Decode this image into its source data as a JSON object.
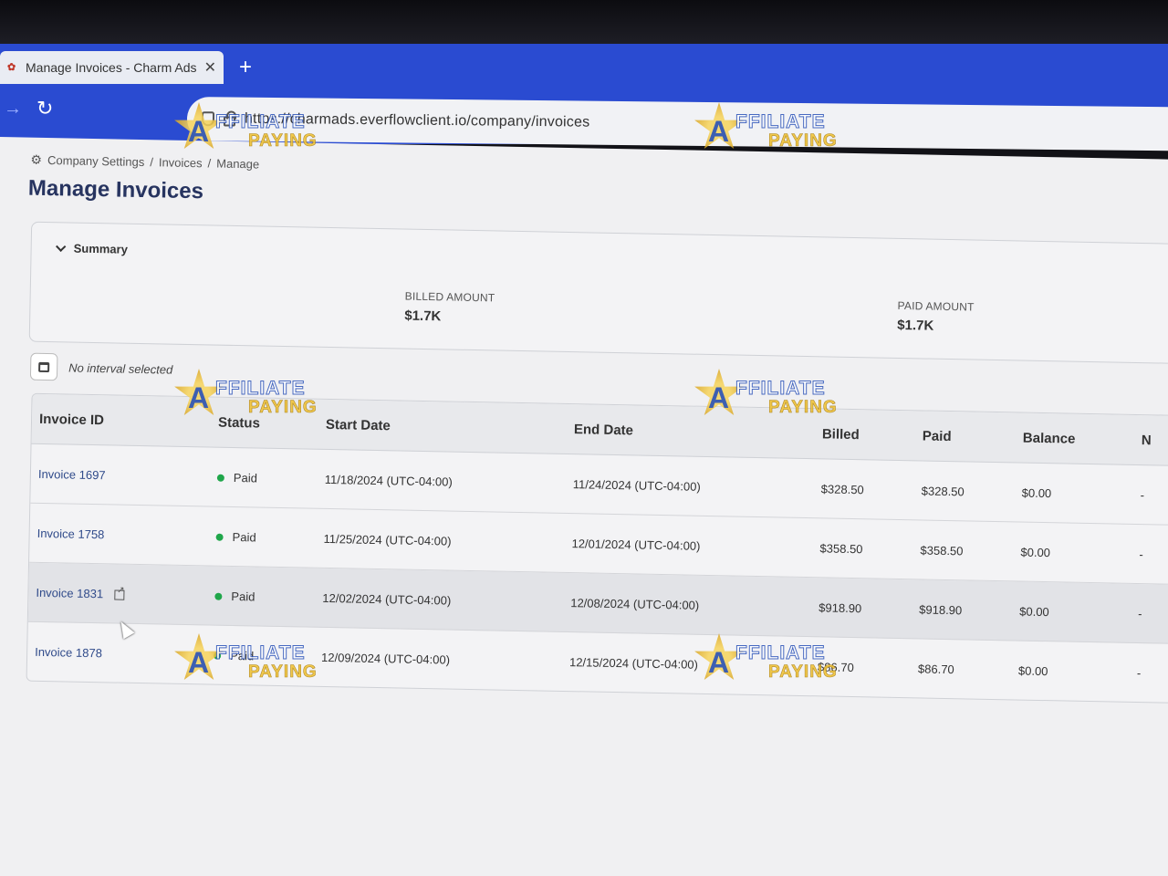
{
  "browser": {
    "tab_title": "Manage Invoices - Charm Ads",
    "tab_close": "✕",
    "new_tab": "+",
    "url": "https://charmads.everflowclient.io/company/invoices"
  },
  "breadcrumb": {
    "items": [
      "Company Settings",
      "Invoices",
      "Manage"
    ],
    "separator": "/"
  },
  "page_title": "Manage Invoices",
  "summary": {
    "toggle_label": "Summary",
    "billed_label": "BILLED AMOUNT",
    "billed_value": "$1.7K",
    "paid_label": "PAID AMOUNT",
    "paid_value": "$1.7K"
  },
  "interval": {
    "text": "No interval selected"
  },
  "table": {
    "headers": [
      "Invoice ID",
      "Status",
      "Start Date",
      "End Date",
      "Billed",
      "Paid",
      "Balance",
      "N"
    ],
    "rows": [
      {
        "id": "Invoice 1697",
        "status": "Paid",
        "start": "11/18/2024 (UTC-04:00)",
        "end": "11/24/2024 (UTC-04:00)",
        "billed": "$328.50",
        "paid": "$328.50",
        "balance": "$0.00",
        "extra": "-"
      },
      {
        "id": "Invoice 1758",
        "status": "Paid",
        "start": "11/25/2024 (UTC-04:00)",
        "end": "12/01/2024 (UTC-04:00)",
        "billed": "$358.50",
        "paid": "$358.50",
        "balance": "$0.00",
        "extra": "-"
      },
      {
        "id": "Invoice 1831",
        "status": "Paid",
        "start": "12/02/2024 (UTC-04:00)",
        "end": "12/08/2024 (UTC-04:00)",
        "billed": "$918.90",
        "paid": "$918.90",
        "balance": "$0.00",
        "extra": "-"
      },
      {
        "id": "Invoice 1878",
        "status": "Paid",
        "start": "12/09/2024 (UTC-04:00)",
        "end": "12/15/2024 (UTC-04:00)",
        "billed": "$86.70",
        "paid": "$86.70",
        "balance": "$0.00",
        "extra": "-"
      }
    ]
  },
  "watermark": {
    "line1": "FFILIATE",
    "line2": "PAYING",
    "initial": "A"
  },
  "colors": {
    "chrome_blue": "#2a4bd1",
    "title_navy": "#273460",
    "paid_green": "#1fa64a"
  }
}
